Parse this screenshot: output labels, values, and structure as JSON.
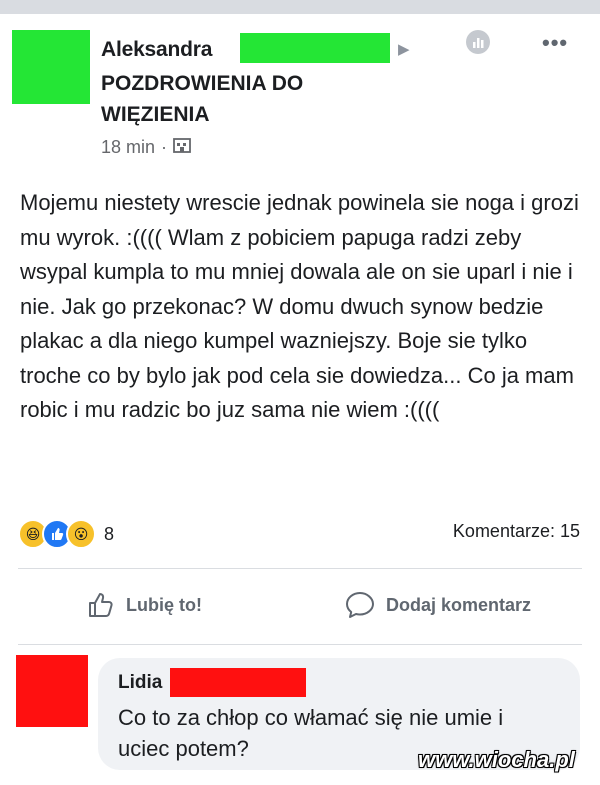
{
  "post": {
    "author": "Aleksandra",
    "group": "POZDROWIENIA DO WIĘZIENIA",
    "time": "18 min",
    "dot": "·",
    "text": "Mojemu niestety wrescie jednak powinela sie noga i grozi mu wyrok. :(((( Wlam z pobiciem papuga radzi zeby wsypal kumpla to mu mniej dowala ale on sie uparl i nie i nie. Jak go przekonac? W domu dwuch synow bedzie plakac a dla niego kumpel wazniejszy. Boje sie tylko troche co by bylo jak pod cela sie dowiedza... Co ja mam robic i mu radzic bo juz sama nie wiem :((((",
    "more_label": "•••"
  },
  "reactions": {
    "icons": [
      "haha-icon",
      "like-icon",
      "wow-icon"
    ],
    "count": "8",
    "comments": "Komentarze: 15"
  },
  "actions": {
    "like": "Lubię to!",
    "comment": "Dodaj komentarz"
  },
  "comment": {
    "name": "Lidia",
    "text": "Co to za chłop co włamać się nie umie i uciec potem?"
  },
  "watermark": "www.wiocha.pl",
  "colors": {
    "redaction_green": "#24e635",
    "redaction_red": "#ff1010",
    "bubble_bg": "#f0f2f5",
    "muted_text": "#65676b",
    "like_blue": "#2078f4"
  }
}
